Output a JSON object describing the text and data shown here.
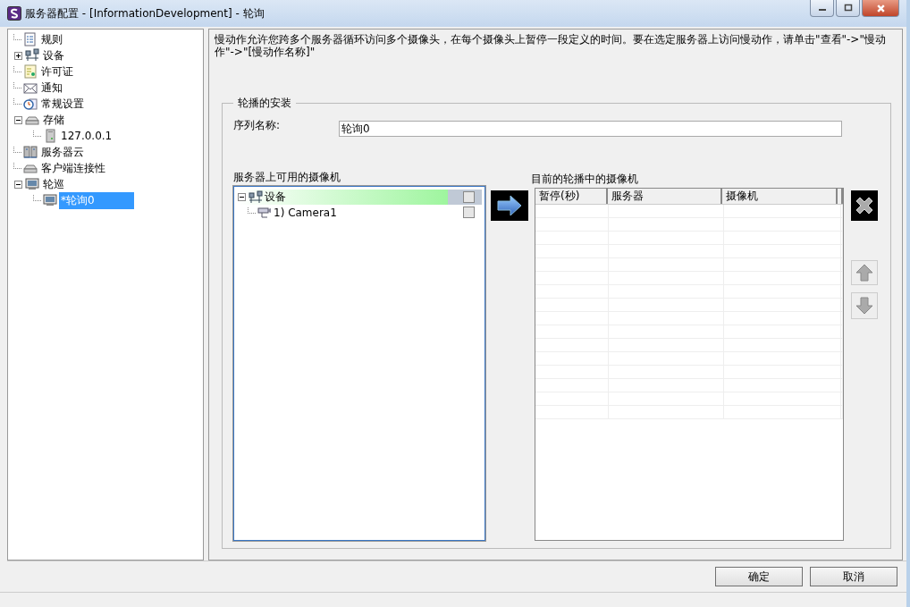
{
  "window": {
    "title": "服务器配置 - [InformationDevelopment] - 轮询"
  },
  "sidebar": {
    "items": [
      {
        "label": "规则",
        "selected": false
      },
      {
        "label": "设备",
        "expanded": false,
        "selected": false
      },
      {
        "label": "许可证",
        "selected": false
      },
      {
        "label": "通知",
        "selected": false
      },
      {
        "label": "常规设置",
        "selected": false
      },
      {
        "label": "存储",
        "expanded": true,
        "selected": false,
        "children": [
          {
            "label": "127.0.0.1",
            "selected": false
          }
        ]
      },
      {
        "label": "服务器云",
        "selected": false
      },
      {
        "label": "客户端连接性",
        "selected": false
      },
      {
        "label": "轮巡",
        "expanded": true,
        "selected": false,
        "children": [
          {
            "label": "*轮询0",
            "selected": true
          }
        ]
      }
    ]
  },
  "description": "慢动作允许您跨多个服务器循环访问多个摄像头，在每个摄像头上暂停一段定义的时间。要在选定服务器上访问慢动作，请单击\"查看\"->\"慢动作\"->\"[慢动作名称]\"",
  "group": {
    "title": "轮播的安装",
    "name_label": "序列名称:",
    "name_value": "轮询0",
    "available": {
      "label": "服务器上可用的摄像机",
      "items": [
        {
          "label": "设备",
          "expanded": true,
          "selected": true,
          "checked": false,
          "children": [
            {
              "label": "1) Camera1",
              "checked": false,
              "selected": false
            }
          ]
        }
      ]
    },
    "current": {
      "label": "目前的轮播中的摄像机",
      "columns": [
        "暂停(秒)",
        "服务器",
        "摄像机"
      ]
    }
  },
  "buttons": [
    {
      "label": "确定"
    },
    {
      "label": "取消"
    }
  ]
}
